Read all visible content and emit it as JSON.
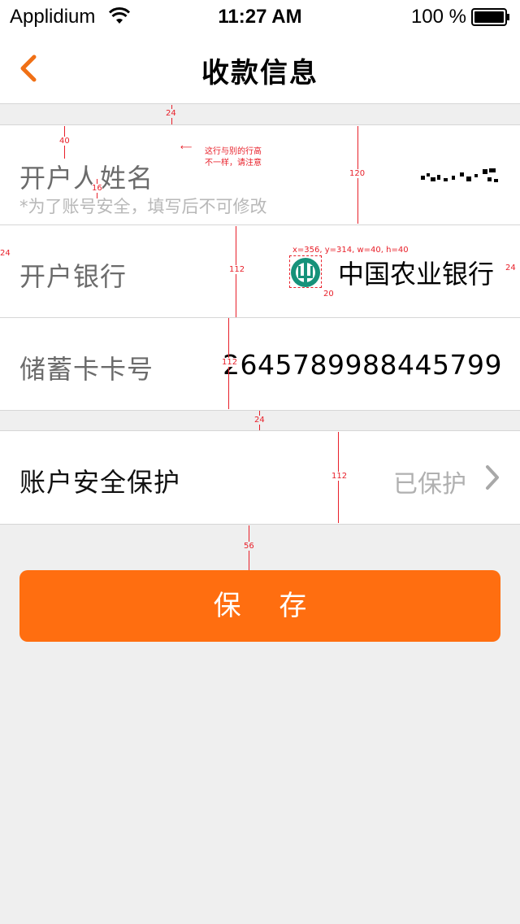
{
  "status_bar": {
    "carrier": "Applidium",
    "time": "11:27 AM",
    "battery": "100 %"
  },
  "nav": {
    "title": "收款信息",
    "back_icon": "chevron-left-icon"
  },
  "form": {
    "account_name": {
      "label": "开户人姓名",
      "hint": "*为了账号安全，填写后不可修改"
    },
    "bank": {
      "label": "开户银行",
      "value": "中国农业银行",
      "logo_icon": "abc-bank-logo-icon"
    },
    "card": {
      "label": "储蓄卡卡号",
      "value": "2645789988445799"
    },
    "security": {
      "label": "账户安全保护",
      "status": "已保护",
      "chevron_icon": "chevron-right-icon"
    }
  },
  "save_button": {
    "label": "保 存"
  },
  "annotations": {
    "gap_nav_row": "24",
    "name_top": "40",
    "name_gap": "16",
    "name_note_line1": "这行与别的行高",
    "name_note_line2": "不一样，请注意",
    "row1_height": "120",
    "left_margin": "24",
    "bank_logo_spec": "x=356, y=314, w=40, h=40",
    "logo_gap": "20",
    "right_margin": "24",
    "row2_height": "112",
    "row3_height": "112",
    "gap_group": "24",
    "row4_height": "112",
    "gap_button": "56"
  },
  "colors": {
    "accent": "#ff6e10",
    "background": "#efefef",
    "annotation": "#e8202a"
  }
}
